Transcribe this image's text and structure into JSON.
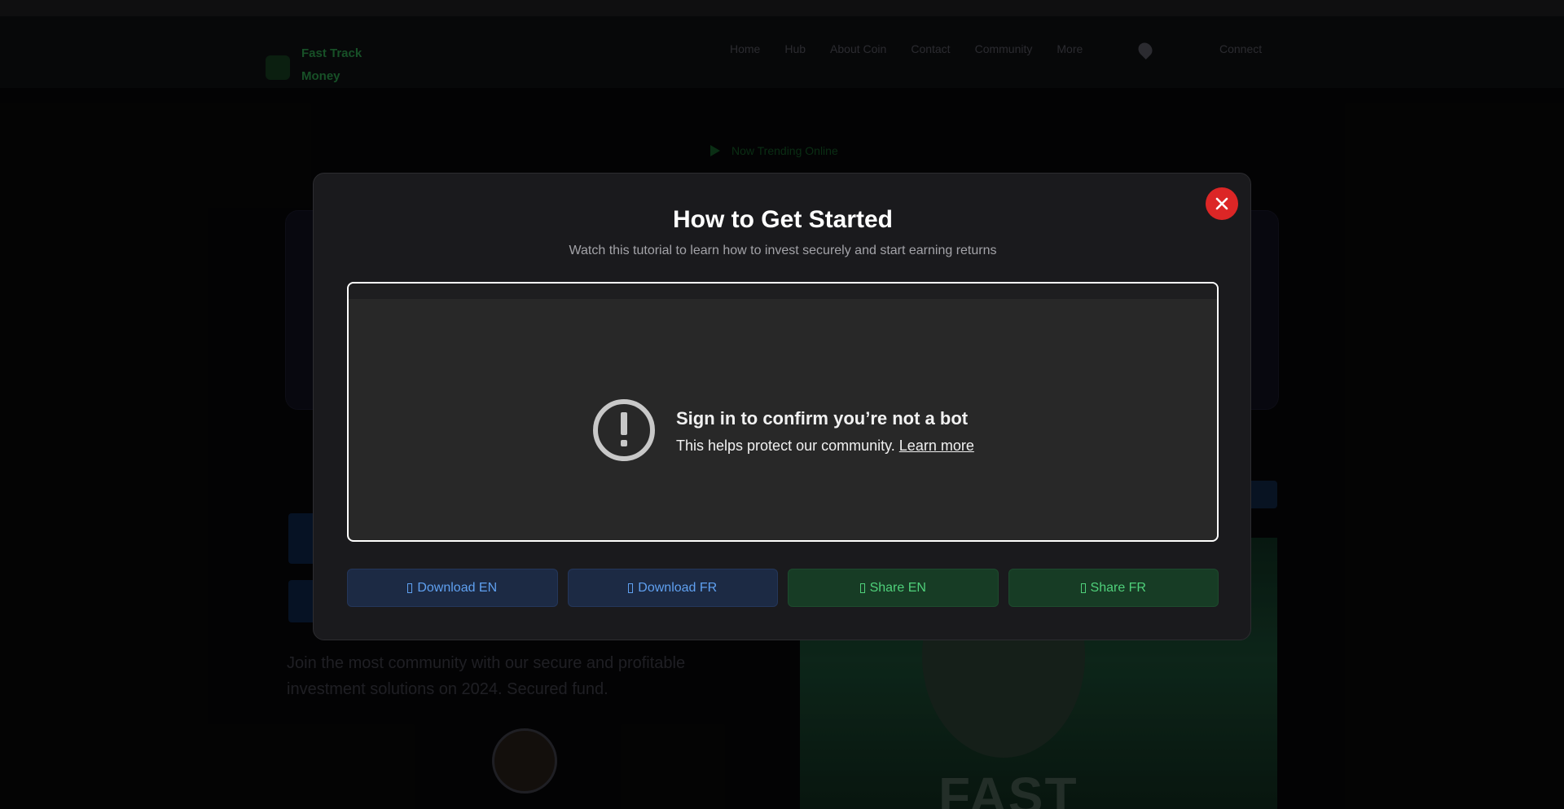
{
  "background": {
    "logo_text": "Fast Track Money",
    "nav_items": [
      "Home",
      "Hub",
      "About Coin",
      "Contact",
      "Community",
      "More"
    ],
    "login_label": "Connect",
    "badge_text": "Now Trending Online",
    "hero_text": "Join the most community with our secure and profitable investment solutions on 2024. Secured fund.",
    "image_word": "FAST"
  },
  "modal": {
    "title": "How to Get Started",
    "subtitle": "Watch this tutorial to learn how to invest securely and start earning returns",
    "close_icon": "close-icon",
    "video": {
      "heading": "Sign in to confirm you’re not a bot",
      "line": "This helps protect our community.",
      "link": "Learn more",
      "icon": "alert-circle-icon"
    },
    "buttons": [
      {
        "label": "Download EN",
        "icon": "download-icon"
      },
      {
        "label": "Download FR",
        "icon": "download-icon"
      },
      {
        "label": "Share EN",
        "icon": "share-icon"
      },
      {
        "label": "Share FR",
        "icon": "share-icon"
      }
    ]
  },
  "colors": {
    "close": "#dc2626",
    "download_bg": "#1c2a44",
    "download_text": "#5fa0f0",
    "share_bg": "#173c25",
    "share_text": "#4fd07a"
  }
}
